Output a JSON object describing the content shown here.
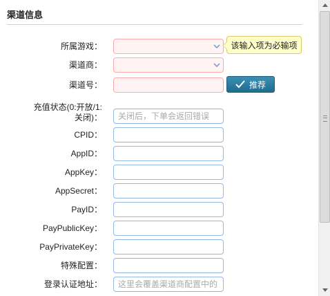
{
  "section": {
    "title": "渠道信息"
  },
  "form": {
    "game_label": "所属游戏：",
    "channel_vendor_label": "渠道商：",
    "channel_no_label": "渠道号：",
    "charge_status_label": "充值状态(0:开放/1:关闭)：",
    "charge_status_placeholder": "关闭后，下单会返回错误",
    "cpid_label": "CPID：",
    "appid_label": "AppID：",
    "appkey_label": "AppKey：",
    "appsecret_label": "AppSecret：",
    "payid_label": "PayID：",
    "paypublickey_label": "PayPublicKey：",
    "payprivatekey_label": "PayPrivateKey：",
    "special_config_label": "特殊配置：",
    "login_auth_label": "登录认证地址：",
    "login_auth_placeholder": "这里会覆盖渠道商配置中的"
  },
  "validation": {
    "required_tooltip": "该输入项为必输项"
  },
  "actions": {
    "recommend_label": "推荐"
  },
  "colors": {
    "field_border": "#95b8e7",
    "invalid_border": "#ffa8a8",
    "invalid_bg": "#fff3f3",
    "tooltip_bg": "#ffffcc",
    "button_bg": "#2a7da2"
  }
}
